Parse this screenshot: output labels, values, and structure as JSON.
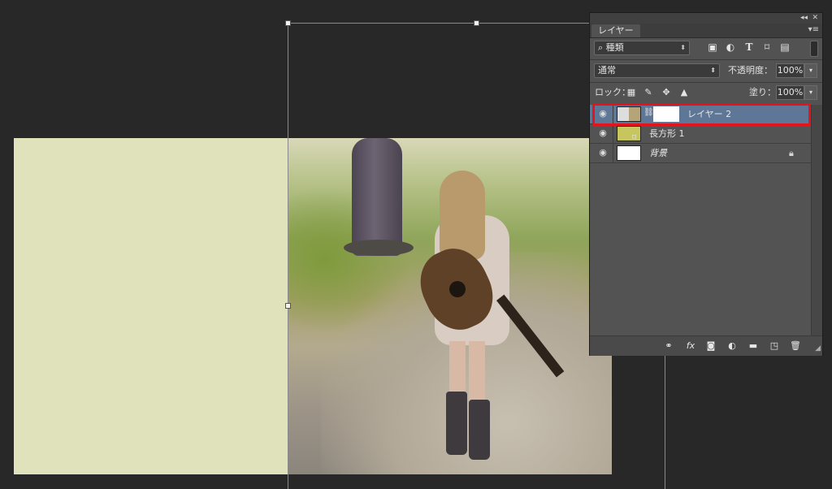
{
  "layers_panel": {
    "tab_label": "レイヤー",
    "collapse_icon": "double-chevron-left",
    "close_icon": "close-x",
    "menu_icon": "panel-menu",
    "filter": {
      "search_glyph": "⌕",
      "kind_label": "種類",
      "icons": [
        "image-filter-icon",
        "adjustment-filter-icon",
        "type-filter-icon",
        "shape-filter-icon",
        "smart-object-filter-icon"
      ]
    },
    "blend_mode": "通常",
    "opacity_label": "不透明度：",
    "opacity_value": "100%",
    "lock_label": "ロック：",
    "lock_icons": [
      "lock-transparent-pixels-icon",
      "lock-image-pixels-icon",
      "lock-position-icon",
      "lock-all-icon"
    ],
    "fill_label": "塗り：",
    "fill_value": "100%",
    "layers": [
      {
        "name": "レイヤー 2",
        "selected": true,
        "visible": true,
        "has_mask": true
      },
      {
        "name": "長方形 1",
        "selected": false,
        "visible": true,
        "thumb_color": "#c6c55e"
      },
      {
        "name": "背景",
        "selected": false,
        "visible": true,
        "locked": true,
        "thumb_color": "#ffffff"
      }
    ],
    "bottom_icons": [
      "link-layers-icon",
      "fx-icon",
      "add-mask-icon",
      "adjustment-layer-icon",
      "new-group-icon",
      "new-layer-icon",
      "delete-layer-icon"
    ],
    "fx_label": "fx"
  },
  "canvas": {
    "swatch_color": "#e0e2bc",
    "highlight_color": "#e3141b",
    "selected_layer_color": "#5f7797"
  }
}
